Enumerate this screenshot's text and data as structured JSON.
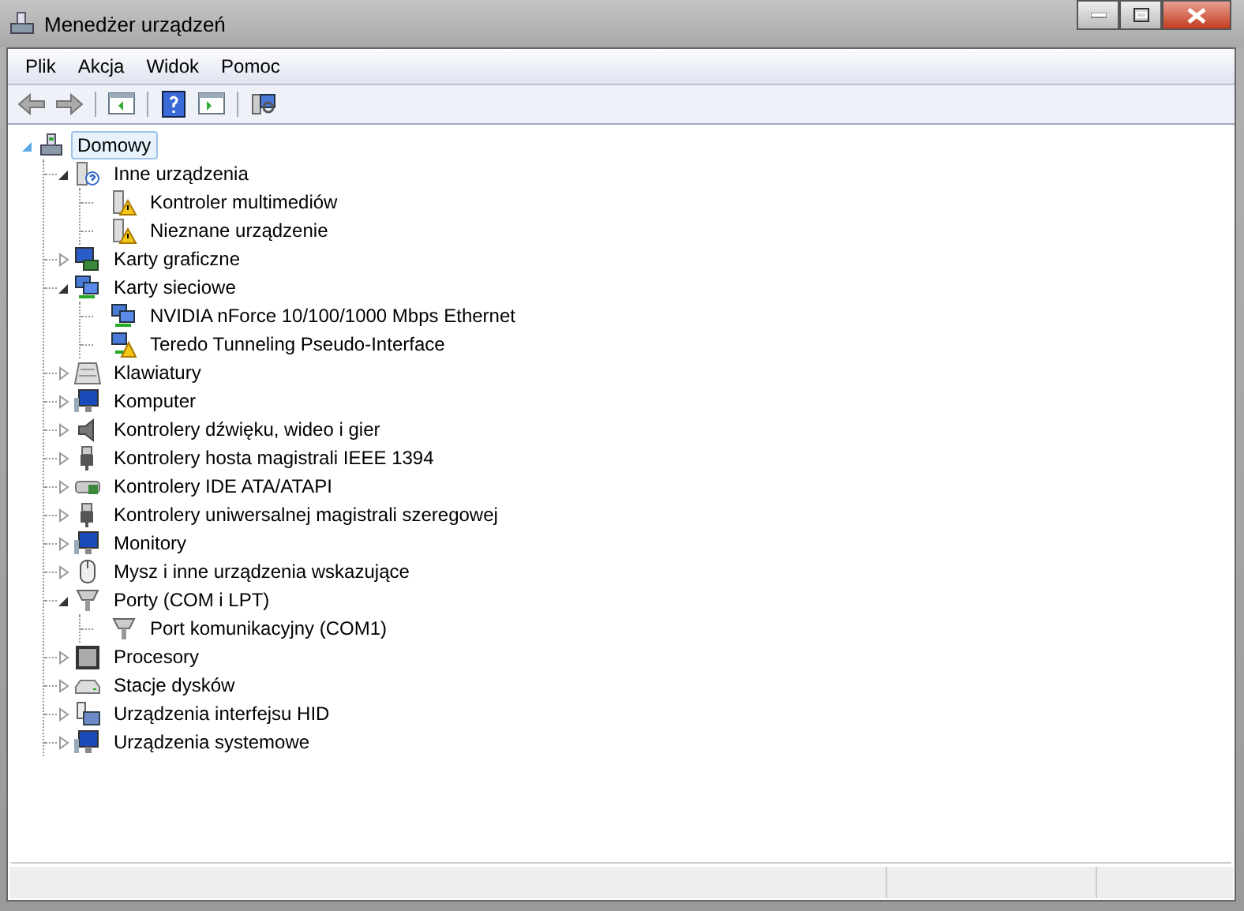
{
  "window": {
    "title": "Menedżer urządzeń"
  },
  "menu": [
    "Plik",
    "Akcja",
    "Widok",
    "Pomoc"
  ],
  "tree": {
    "label": "Domowy",
    "kind": "computer",
    "selected": true,
    "expanded": true,
    "children": [
      {
        "label": "Inne urządzenia",
        "kind": "unknown",
        "selected": false,
        "expanded": true,
        "children": [
          {
            "label": "Kontroler multimediów",
            "kind": "warning",
            "selected": false
          },
          {
            "label": "Nieznane urządzenie",
            "kind": "warning",
            "selected": false
          }
        ]
      },
      {
        "label": "Karty graficzne",
        "kind": "display",
        "selected": false,
        "expanded": false
      },
      {
        "label": "Karty sieciowe",
        "kind": "network",
        "selected": false,
        "expanded": true,
        "children": [
          {
            "label": "NVIDIA nForce 10/100/1000 Mbps Ethernet",
            "kind": "network",
            "selected": false
          },
          {
            "label": "Teredo Tunneling Pseudo-Interface",
            "kind": "netwarn",
            "selected": false
          }
        ]
      },
      {
        "label": "Klawiatury",
        "kind": "keyboard",
        "selected": false,
        "expanded": false
      },
      {
        "label": "Komputer",
        "kind": "monitor",
        "selected": false,
        "expanded": false
      },
      {
        "label": "Kontrolery dźwięku, wideo i gier",
        "kind": "audio",
        "selected": false,
        "expanded": false
      },
      {
        "label": "Kontrolery hosta magistrali IEEE 1394",
        "kind": "plug",
        "selected": false,
        "expanded": false
      },
      {
        "label": "Kontrolery IDE ATA/ATAPI",
        "kind": "ide",
        "selected": false,
        "expanded": false
      },
      {
        "label": "Kontrolery uniwersalnej magistrali szeregowej",
        "kind": "plug",
        "selected": false,
        "expanded": false
      },
      {
        "label": "Monitory",
        "kind": "monitor",
        "selected": false,
        "expanded": false
      },
      {
        "label": "Mysz i inne urządzenia wskazujące",
        "kind": "mouse",
        "selected": false,
        "expanded": false
      },
      {
        "label": "Porty (COM i LPT)",
        "kind": "port",
        "selected": false,
        "expanded": true,
        "children": [
          {
            "label": "Port komunikacyjny (COM1)",
            "kind": "port",
            "selected": false
          }
        ]
      },
      {
        "label": "Procesory",
        "kind": "cpu",
        "selected": false,
        "expanded": false
      },
      {
        "label": "Stacje dysków",
        "kind": "disk",
        "selected": false,
        "expanded": false
      },
      {
        "label": "Urządzenia interfejsu HID",
        "kind": "hid",
        "selected": false,
        "expanded": false
      },
      {
        "label": "Urządzenia systemowe",
        "kind": "monitor",
        "selected": false,
        "expanded": false
      }
    ]
  }
}
